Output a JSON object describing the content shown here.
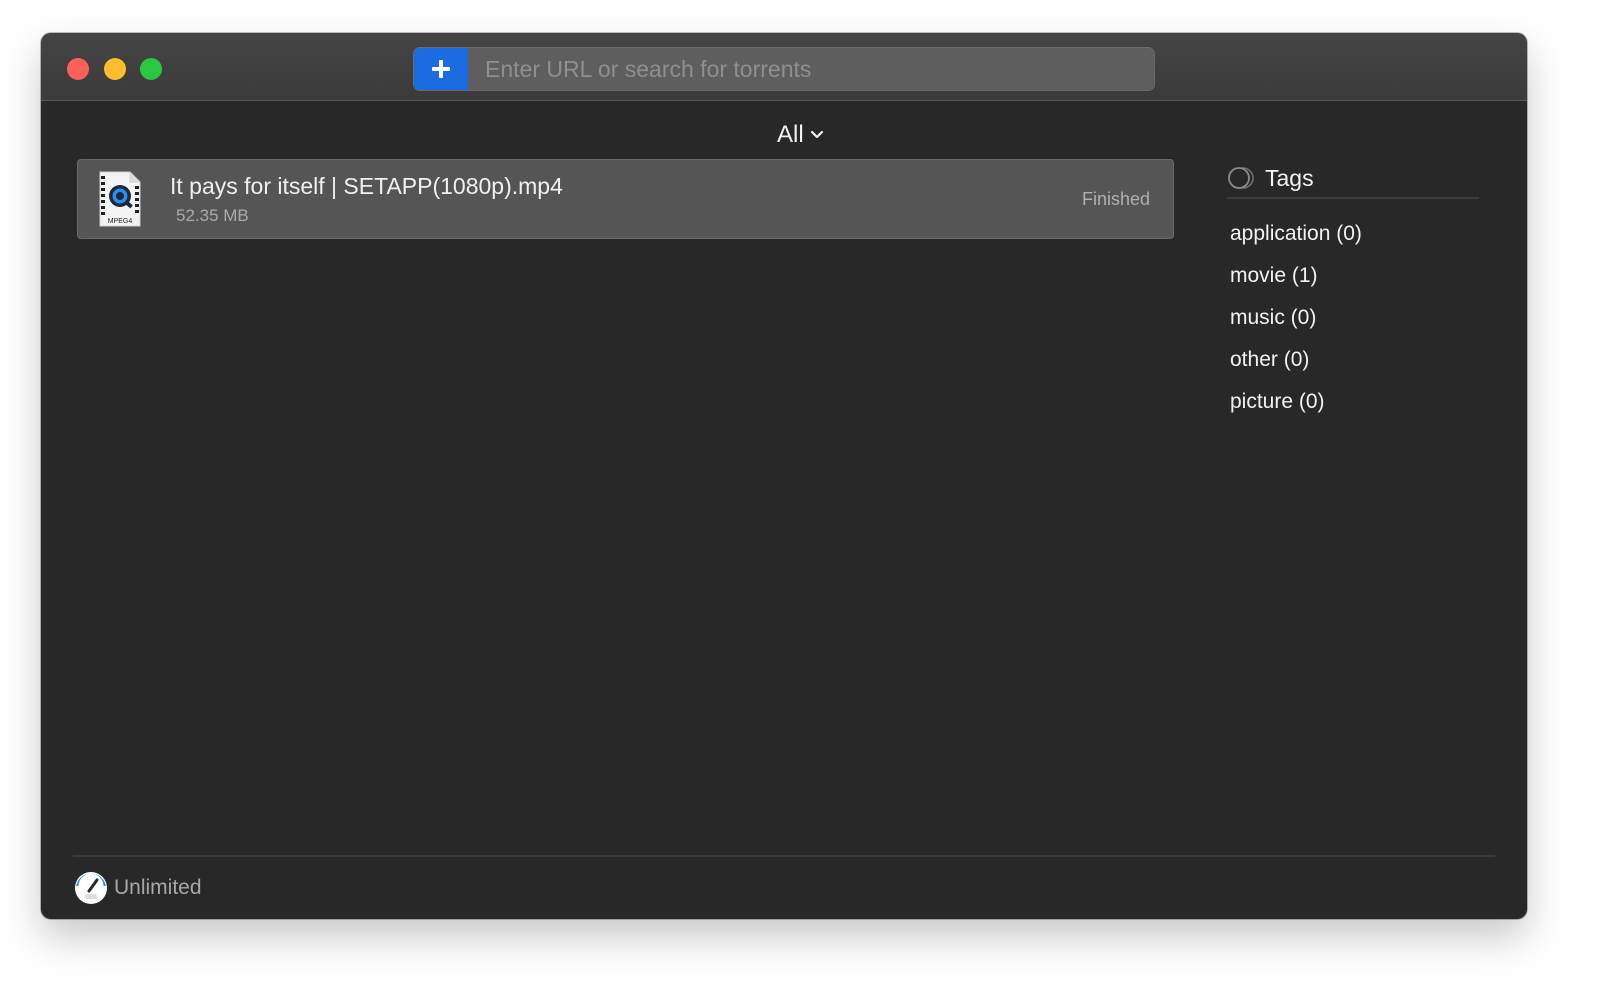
{
  "window": {
    "controls": {
      "close": "close",
      "minimize": "minimize",
      "zoom": "zoom"
    }
  },
  "toolbar": {
    "add_icon": "plus-icon",
    "search_placeholder": "Enter URL or search for torrents",
    "search_value": ""
  },
  "filter": {
    "selected": "All",
    "icon": "chevron-down-icon"
  },
  "torrents": [
    {
      "icon": "mpeg4-file-icon",
      "icon_label": "MPEG4",
      "name": "It pays for itself | SETAPP(1080p).mp4",
      "size": "52.35 MB",
      "status": "Finished"
    }
  ],
  "tags": {
    "title": "Tags",
    "items": [
      {
        "label": "application (0)"
      },
      {
        "label": "movie (1)"
      },
      {
        "label": "music (0)"
      },
      {
        "label": "other (0)"
      },
      {
        "label": "picture (0)"
      }
    ]
  },
  "footer": {
    "speed_icon": "speedometer-icon",
    "speed_label": "Unlimited"
  },
  "colors": {
    "accent": "#1a6ce0",
    "window_bg": "#282828",
    "titlebar": "#3f3f3f",
    "row_bg": "#555555",
    "close": "#fe5f57",
    "minimize": "#febc2e",
    "zoom": "#28c840"
  }
}
